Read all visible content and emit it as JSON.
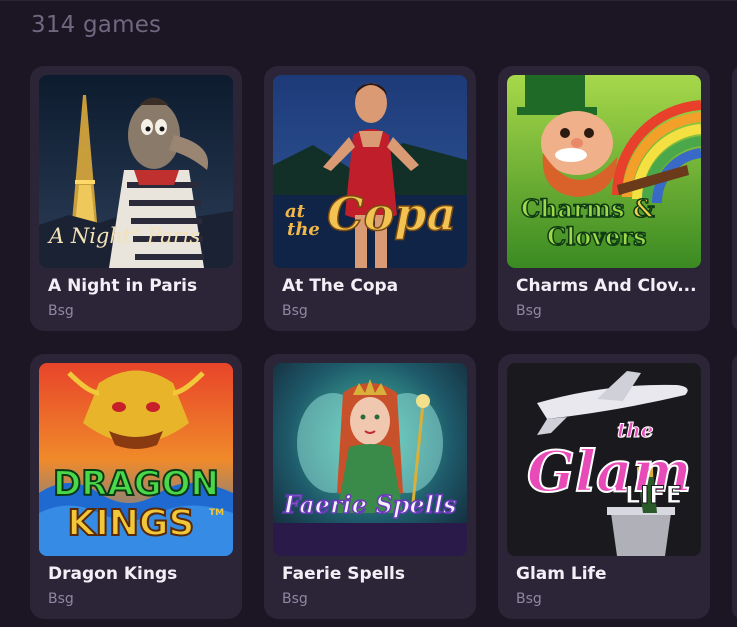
{
  "header": {
    "count_label": "314 games"
  },
  "games": [
    {
      "title": "A Night in Paris",
      "provider": "Bsg",
      "logo_text_1": "A Night",
      "logo_text_2": "in",
      "logo_text_3": "Paris"
    },
    {
      "title": "At The Copa",
      "provider": "Bsg",
      "logo_text_1": "at",
      "logo_text_2": "the",
      "logo_text_3": "Copa"
    },
    {
      "title": "Charms And Clov...",
      "provider": "Bsg",
      "logo_text_1": "Charms",
      "logo_text_2": "&",
      "logo_text_3": "Clovers"
    },
    {
      "title": "Dragon Kings",
      "provider": "Bsg",
      "logo_text_1": "DRAGON",
      "logo_text_2": "KINGS",
      "logo_text_3": "TM"
    },
    {
      "title": "Faerie Spells",
      "provider": "Bsg",
      "logo_text_1": "Faerie Spells"
    },
    {
      "title": "Glam Life",
      "provider": "Bsg",
      "logo_text_1": "the",
      "logo_text_2": "Glam",
      "logo_text_3": "LIFE"
    }
  ]
}
